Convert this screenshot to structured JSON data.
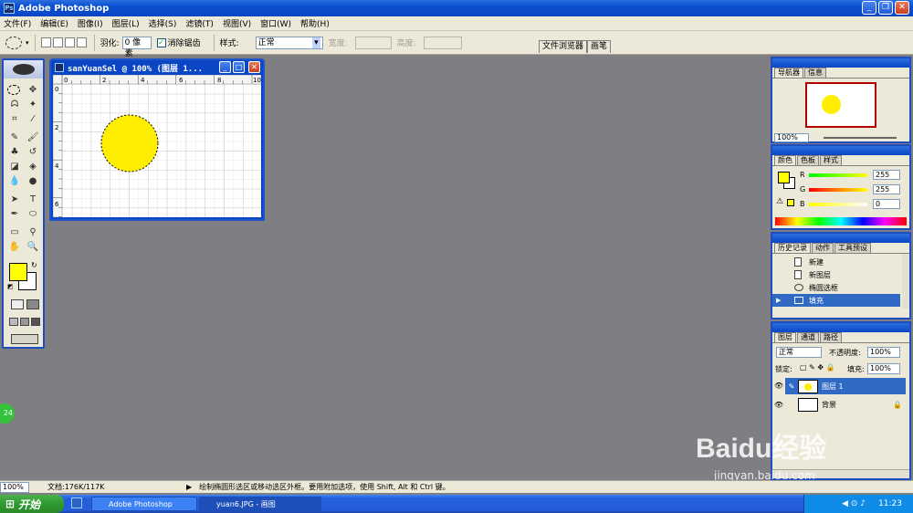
{
  "window": {
    "title": "Adobe Photoshop"
  },
  "menu": [
    "文件(F)",
    "编辑(E)",
    "图像(I)",
    "图层(L)",
    "选择(S)",
    "滤镜(T)",
    "视图(V)",
    "窗口(W)",
    "帮助(H)"
  ],
  "options": {
    "feather_label": "羽化:",
    "feather_value": "0 像素",
    "antialias_label": "消除锯齿",
    "style_label": "样式:",
    "style_value": "正常",
    "width_label": "宽度:",
    "height_label": "高度:",
    "file_browser_tab": "文件浏览器",
    "brushes_tab": "画笔"
  },
  "document": {
    "title": "sanYuanSel @ 100% (图层 1...",
    "ruler_top": [
      "0",
      "2",
      "4",
      "6",
      "8",
      "10"
    ],
    "ruler_left": [
      "0",
      "2",
      "4",
      "6"
    ],
    "circle_color": "#ffee00"
  },
  "navigator": {
    "tabs": [
      "导航器",
      "信息"
    ],
    "zoom": "100%"
  },
  "color_panel": {
    "tabs": [
      "颜色",
      "色板",
      "样式"
    ],
    "r_label": "R",
    "g_label": "G",
    "b_label": "B",
    "r_value": "255",
    "g_value": "255",
    "b_value": "0",
    "foreground": "#ffff00"
  },
  "history_panel": {
    "tabs": [
      "历史记录",
      "动作",
      "工具预设"
    ],
    "items": [
      "新建",
      "新图层",
      "椭圆选框",
      "填充"
    ]
  },
  "layers_panel": {
    "tabs": [
      "图层",
      "通道",
      "路径"
    ],
    "blend_mode": "正常",
    "opacity_label": "不透明度:",
    "opacity_value": "100%",
    "lock_label": "锁定:",
    "fill_label": "填充:",
    "fill_value": "100%",
    "layers": [
      "图层 1",
      "背景"
    ]
  },
  "status": {
    "zoom": "100%",
    "doc_info": "文档:176K/117K",
    "hint": "绘制椭圆形选区或移动选区外框。要用附加选项，使用 Shift, Alt 和 Ctrl 键。"
  },
  "taskbar": {
    "start": "开始",
    "items": [
      "Adobe Photoshop",
      "yuan6.JPG - 画图"
    ],
    "time": "11:23"
  },
  "watermark": {
    "brand": "Baidu经验",
    "url": "jingyan.baidu.com"
  },
  "green_badge": "24"
}
